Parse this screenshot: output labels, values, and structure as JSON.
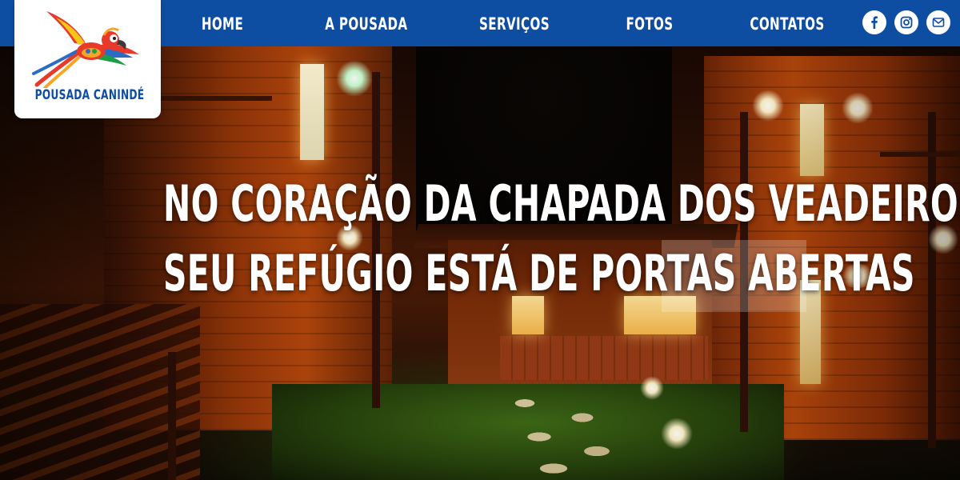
{
  "brand": {
    "name": "POUSADA CANINDÉ",
    "logo_icon": "macaw-logo-icon"
  },
  "nav": {
    "items": [
      {
        "label": "HOME"
      },
      {
        "label": "A POUSADA"
      },
      {
        "label": "SERVIÇOS"
      },
      {
        "label": "FOTOS"
      },
      {
        "label": "CONTATOS"
      }
    ]
  },
  "social": {
    "icons": [
      "facebook-icon",
      "instagram-icon",
      "email-icon"
    ]
  },
  "hero": {
    "headline_line1": "NO CORAÇÃO DA CHAPADA DOS VEADEIROS,",
    "headline_line2": "SEU REFÚGIO ESTÁ DE PORTAS ABERTAS"
  },
  "colors": {
    "nav_background": "#0d4ea3",
    "brand_text": "#0d4ea3",
    "headline_text": "#ffffff"
  }
}
